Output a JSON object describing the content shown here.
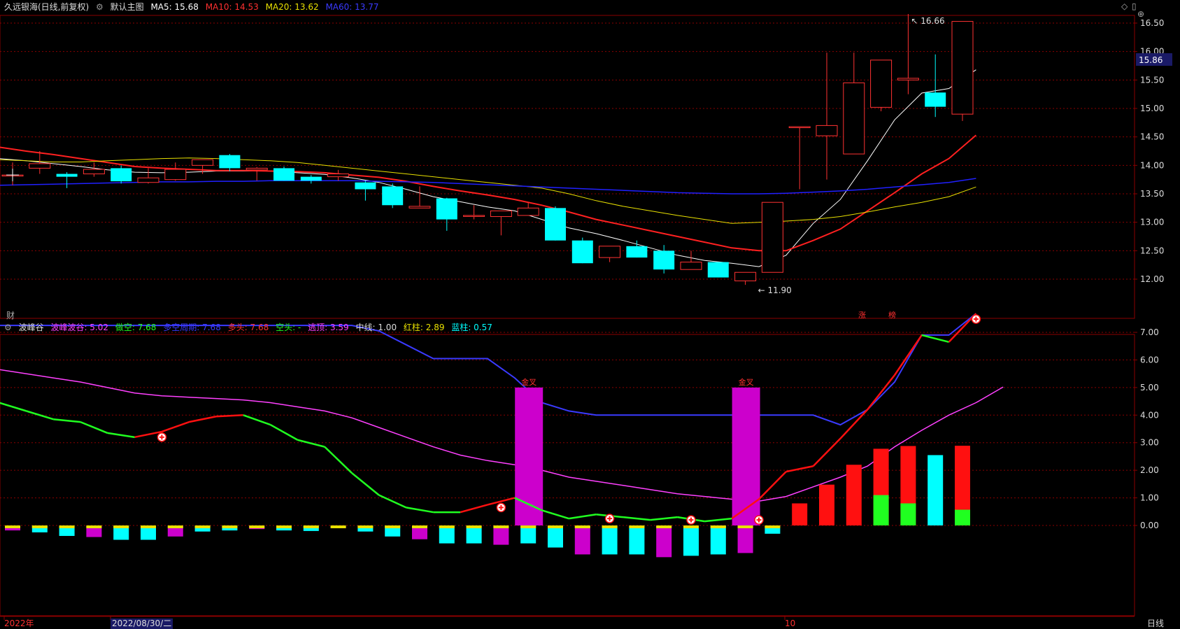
{
  "main_header": {
    "stock": "久远银海(日线,前复权)",
    "indicator": "默认主图",
    "ma5": "MA5: 15.68",
    "ma10": "MA10: 14.53",
    "ma20": "MA20: 13.62",
    "ma60": "MA60: 13.77"
  },
  "sub_header": {
    "name": "波峰谷",
    "bfbg": "波峰波谷: 5.02",
    "zk": "做空: 7.68",
    "dkzq": "多空周期: 7.68",
    "dt": "多头: 7.68",
    "kt": "空头: -",
    "tg": "逃顶: 3.59",
    "zx": "中线: 1.00",
    "hz": "红柱: 2.89",
    "lz": "蓝柱: 0.57"
  },
  "markers": {
    "cai": "财",
    "zhang": "涨",
    "bang": "榜",
    "gold1": "金叉",
    "gold2": "金叉",
    "max_label": "16.66",
    "min_label": "11.90",
    "current_price": "15.86"
  },
  "bottom_bar": {
    "year": "2022年",
    "date": "2022/08/30/二",
    "month": "10",
    "period": "日线"
  },
  "colors": {
    "up": "#ff3232",
    "down": "#00ffff",
    "ma5": "#ffffff",
    "ma10": "#ff2020",
    "ma20": "#e8e000",
    "ma60": "#2020ff",
    "grid": "#8b0000"
  },
  "chart_data": [
    {
      "type": "candlestick",
      "title": "默认主图",
      "y_ticks": [
        12.0,
        12.5,
        13.0,
        13.5,
        14.0,
        14.5,
        15.0,
        15.5,
        16.0,
        16.5
      ],
      "ylim": [
        11.75,
        16.75
      ],
      "candles": [
        {
          "o": 13.83,
          "c": 13.83,
          "h": 14.05,
          "l": 13.65
        },
        {
          "o": 13.95,
          "c": 14.03,
          "h": 14.25,
          "l": 13.85
        },
        {
          "o": 13.85,
          "c": 13.8,
          "h": 13.88,
          "l": 13.6
        },
        {
          "o": 13.85,
          "c": 13.93,
          "h": 14.05,
          "l": 13.8
        },
        {
          "o": 13.95,
          "c": 13.72,
          "h": 14.0,
          "l": 13.68
        },
        {
          "o": 13.7,
          "c": 13.78,
          "h": 13.95,
          "l": 13.68
        },
        {
          "o": 13.75,
          "c": 13.93,
          "h": 14.05,
          "l": 13.73
        },
        {
          "o": 14.0,
          "c": 14.1,
          "h": 14.1,
          "l": 13.85
        },
        {
          "o": 14.18,
          "c": 13.95,
          "h": 14.2,
          "l": 13.9
        },
        {
          "o": 13.92,
          "c": 13.95,
          "h": 13.97,
          "l": 13.73
        },
        {
          "o": 13.95,
          "c": 13.73,
          "h": 13.98,
          "l": 13.73
        },
        {
          "o": 13.8,
          "c": 13.73,
          "h": 13.83,
          "l": 13.68
        },
        {
          "o": 13.8,
          "c": 13.85,
          "h": 13.92,
          "l": 13.73
        },
        {
          "o": 13.7,
          "c": 13.58,
          "h": 13.73,
          "l": 13.38
        },
        {
          "o": 13.63,
          "c": 13.3,
          "h": 13.68,
          "l": 13.25
        },
        {
          "o": 13.25,
          "c": 13.28,
          "h": 13.63,
          "l": 13.25
        },
        {
          "o": 13.42,
          "c": 13.05,
          "h": 13.43,
          "l": 12.85
        },
        {
          "o": 13.12,
          "c": 13.12,
          "h": 13.3,
          "l": 13.05
        },
        {
          "o": 13.1,
          "c": 13.2,
          "h": 13.2,
          "l": 12.77
        },
        {
          "o": 13.12,
          "c": 13.25,
          "h": 13.35,
          "l": 13.12
        },
        {
          "o": 13.25,
          "c": 12.68,
          "h": 13.28,
          "l": 12.68
        },
        {
          "o": 12.68,
          "c": 12.28,
          "h": 12.73,
          "l": 12.28
        },
        {
          "o": 12.38,
          "c": 12.58,
          "h": 12.58,
          "l": 12.3
        },
        {
          "o": 12.58,
          "c": 12.38,
          "h": 12.68,
          "l": 12.38
        },
        {
          "o": 12.5,
          "c": 12.17,
          "h": 12.6,
          "l": 12.1
        },
        {
          "o": 12.17,
          "c": 12.3,
          "h": 12.5,
          "l": 12.17
        },
        {
          "o": 12.3,
          "c": 12.03,
          "h": 12.3,
          "l": 12.03
        },
        {
          "o": 11.97,
          "c": 12.12,
          "h": 12.12,
          "l": 11.9
        },
        {
          "o": 12.12,
          "c": 13.35,
          "h": 13.35,
          "l": 12.12
        },
        {
          "o": 14.68,
          "c": 14.68,
          "h": 14.68,
          "l": 13.58
        },
        {
          "o": 14.52,
          "c": 14.7,
          "h": 15.98,
          "l": 13.75
        },
        {
          "o": 14.2,
          "c": 15.45,
          "h": 15.98,
          "l": 14.2
        },
        {
          "o": 15.02,
          "c": 15.85,
          "h": 15.85,
          "l": 14.95
        },
        {
          "o": 15.5,
          "c": 15.53,
          "h": 16.66,
          "l": 15.25
        },
        {
          "o": 15.28,
          "c": 15.03,
          "h": 15.95,
          "l": 14.85
        },
        {
          "o": 14.9,
          "c": 16.53,
          "h": 16.53,
          "l": 14.78
        }
      ],
      "series": [
        {
          "name": "MA5",
          "values": [
            14.12,
            14.08,
            14.03,
            13.98,
            13.92,
            13.88,
            13.87,
            13.88,
            13.9,
            13.9,
            13.9,
            13.87,
            13.84,
            13.78,
            13.7,
            13.58,
            13.45,
            13.36,
            13.27,
            13.2,
            13.05,
            12.9,
            12.8,
            12.68,
            12.55,
            12.42,
            12.33,
            12.28,
            12.22,
            12.42,
            12.98,
            13.4,
            14.08,
            14.8,
            15.27,
            15.35,
            15.68
          ]
        },
        {
          "name": "MA10",
          "values": [
            14.32,
            14.25,
            14.19,
            14.12,
            14.05,
            13.98,
            13.95,
            13.93,
            13.91,
            13.91,
            13.9,
            13.89,
            13.87,
            13.83,
            13.79,
            13.72,
            13.63,
            13.55,
            13.48,
            13.4,
            13.3,
            13.18,
            13.05,
            12.95,
            12.85,
            12.75,
            12.65,
            12.55,
            12.5,
            12.5,
            12.68,
            12.88,
            13.2,
            13.52,
            13.85,
            14.12,
            14.53
          ]
        },
        {
          "name": "MA20",
          "values": [
            14.1,
            14.08,
            14.06,
            14.06,
            14.08,
            14.1,
            14.12,
            14.13,
            14.12,
            14.1,
            14.08,
            14.05,
            14.0,
            13.95,
            13.9,
            13.85,
            13.8,
            13.75,
            13.7,
            13.65,
            13.6,
            13.5,
            13.38,
            13.28,
            13.2,
            13.12,
            13.05,
            12.98,
            13.0,
            13.02,
            13.05,
            13.1,
            13.18,
            13.27,
            13.35,
            13.45,
            13.62
          ]
        },
        {
          "name": "MA60",
          "values": [
            13.65,
            13.66,
            13.67,
            13.68,
            13.69,
            13.7,
            13.71,
            13.71,
            13.72,
            13.72,
            13.73,
            13.73,
            13.73,
            13.73,
            13.72,
            13.71,
            13.7,
            13.68,
            13.66,
            13.64,
            13.62,
            13.6,
            13.58,
            13.56,
            13.54,
            13.52,
            13.51,
            13.5,
            13.5,
            13.51,
            13.53,
            13.55,
            13.58,
            13.62,
            13.66,
            13.7,
            13.77
          ]
        }
      ]
    },
    {
      "type": "bar",
      "title": "波峰谷",
      "y_ticks": [
        0.0,
        1.0,
        2.0,
        3.0,
        4.0,
        5.0,
        6.0,
        7.0
      ],
      "ylim": [
        -1.8,
        8.2
      ],
      "series": [
        {
          "name": "做空",
          "values": [
            7.25,
            7.25,
            7.25,
            7.25,
            7.25,
            7.25,
            7.25,
            7.25,
            7.25,
            7.25,
            7.25,
            7.25,
            7.25,
            7.25,
            7.05,
            6.55,
            6.05,
            6.05,
            6.05,
            5.35,
            4.45,
            4.15,
            4.0,
            4.0,
            4.0,
            4.0,
            4.0,
            4.0,
            4.0,
            4.0,
            4.0,
            3.65,
            4.2,
            5.2,
            6.9,
            6.9,
            7.68
          ]
        },
        {
          "name": "逃顶",
          "values": [
            5.65,
            5.5,
            5.35,
            5.2,
            5.0,
            4.8,
            4.7,
            4.65,
            4.6,
            4.55,
            4.45,
            4.3,
            4.15,
            3.9,
            3.55,
            3.2,
            2.85,
            2.55,
            2.35,
            2.2,
            2.0,
            1.75,
            1.6,
            1.45,
            1.3,
            1.15,
            1.05,
            0.95,
            0.88,
            1.05,
            1.4,
            1.75,
            2.15,
            2.85,
            3.45,
            4.0,
            4.45,
            5.02
          ]
        },
        {
          "name": "波峰波谷",
          "values": [
            4.45,
            4.15,
            3.85,
            3.75,
            3.35,
            3.2,
            3.4,
            3.75,
            3.95,
            4.0,
            3.65,
            3.1,
            2.85,
            1.9,
            1.1,
            0.65,
            0.48,
            0.48,
            0.75,
            1.0,
            0.55,
            0.25,
            0.4,
            0.3,
            0.2,
            0.3,
            0.15,
            0.25,
            0.95,
            1.95,
            2.15,
            3.15,
            4.2,
            5.45,
            6.9,
            6.65,
            7.68
          ]
        },
        {
          "name": "红柱",
          "values": [
            0,
            0,
            0,
            0,
            0,
            0,
            0,
            0,
            0,
            0,
            0,
            0,
            0,
            0,
            0,
            0,
            0,
            0,
            0,
            0,
            0,
            0,
            0,
            0,
            0,
            0,
            0,
            0,
            0,
            0.8,
            1.48,
            2.2,
            2.78,
            2.88,
            0,
            2.89
          ]
        },
        {
          "name": "蓝柱",
          "values": [
            -0.18,
            -0.25,
            -0.38,
            -0.42,
            -0.52,
            -0.52,
            -0.4,
            -0.22,
            -0.18,
            -0.13,
            -0.18,
            -0.2,
            -0.1,
            -0.22,
            -0.4,
            -0.5,
            -0.65,
            -0.65,
            -0.7,
            -0.65,
            -0.8,
            -1.05,
            -1.05,
            -1.05,
            -1.15,
            -1.1,
            -1.05,
            -1.0,
            -0.3,
            0,
            0,
            0,
            1.1,
            0.8,
            2.55,
            0.57
          ]
        },
        {
          "name": "金叉",
          "values": [
            5.0,
            5.0
          ]
        }
      ]
    }
  ]
}
